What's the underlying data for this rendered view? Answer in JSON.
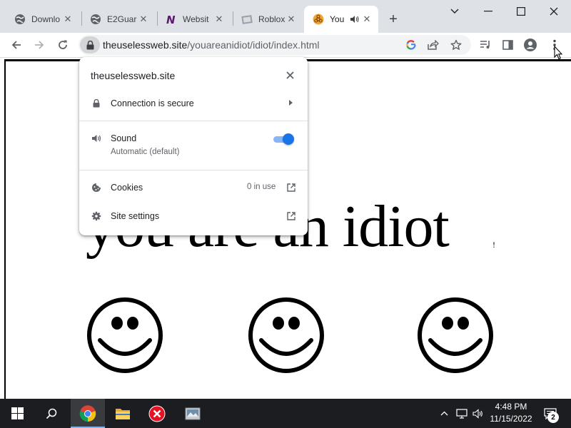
{
  "browser": {
    "tabs": [
      {
        "title": "Downlo",
        "favicon": "globe-icon",
        "active": false
      },
      {
        "title": "E2Guar",
        "favicon": "globe-icon",
        "active": false
      },
      {
        "title": "Websit",
        "favicon": "n-logo-icon",
        "active": false
      },
      {
        "title": "Roblox",
        "favicon": "image-icon",
        "active": false
      },
      {
        "title": "You",
        "favicon": "biohazard-icon",
        "active": true,
        "audio": "speaker-icon"
      }
    ],
    "new_tab_label": "+",
    "address": {
      "domain": "theuselessweb.site",
      "path": "/youareanidiot/idiot/index.html"
    },
    "toolbar_icons": [
      "back-icon",
      "forward-icon",
      "reload-icon",
      "google-lens-icon",
      "share-icon",
      "star-icon",
      "media-control-icon",
      "side-panel-icon",
      "profile-icon",
      "menu-icon"
    ]
  },
  "site_info_popup": {
    "title": "theuselessweb.site",
    "connection": "Connection is secure",
    "sound_label": "Sound",
    "sound_sub": "Automatic (default)",
    "sound_enabled": true,
    "cookies_label": "Cookies",
    "cookies_value": "0 in use",
    "site_settings_label": "Site settings"
  },
  "page": {
    "headline": "you are an idiot",
    "headline_tail": "!",
    "smiley_count": 3
  },
  "taskbar": {
    "time": "4:48 PM",
    "date": "11/15/2022",
    "notification_count": "2",
    "apps": [
      "chrome-icon",
      "file-explorer-icon",
      "red-x-app-icon",
      "image-app-icon"
    ]
  },
  "colors": {
    "accent": "#1a73e8",
    "toggle_track": "#8ab4f8",
    "tabstrip": "#dee1e6",
    "taskbar": "#1c1d20"
  }
}
